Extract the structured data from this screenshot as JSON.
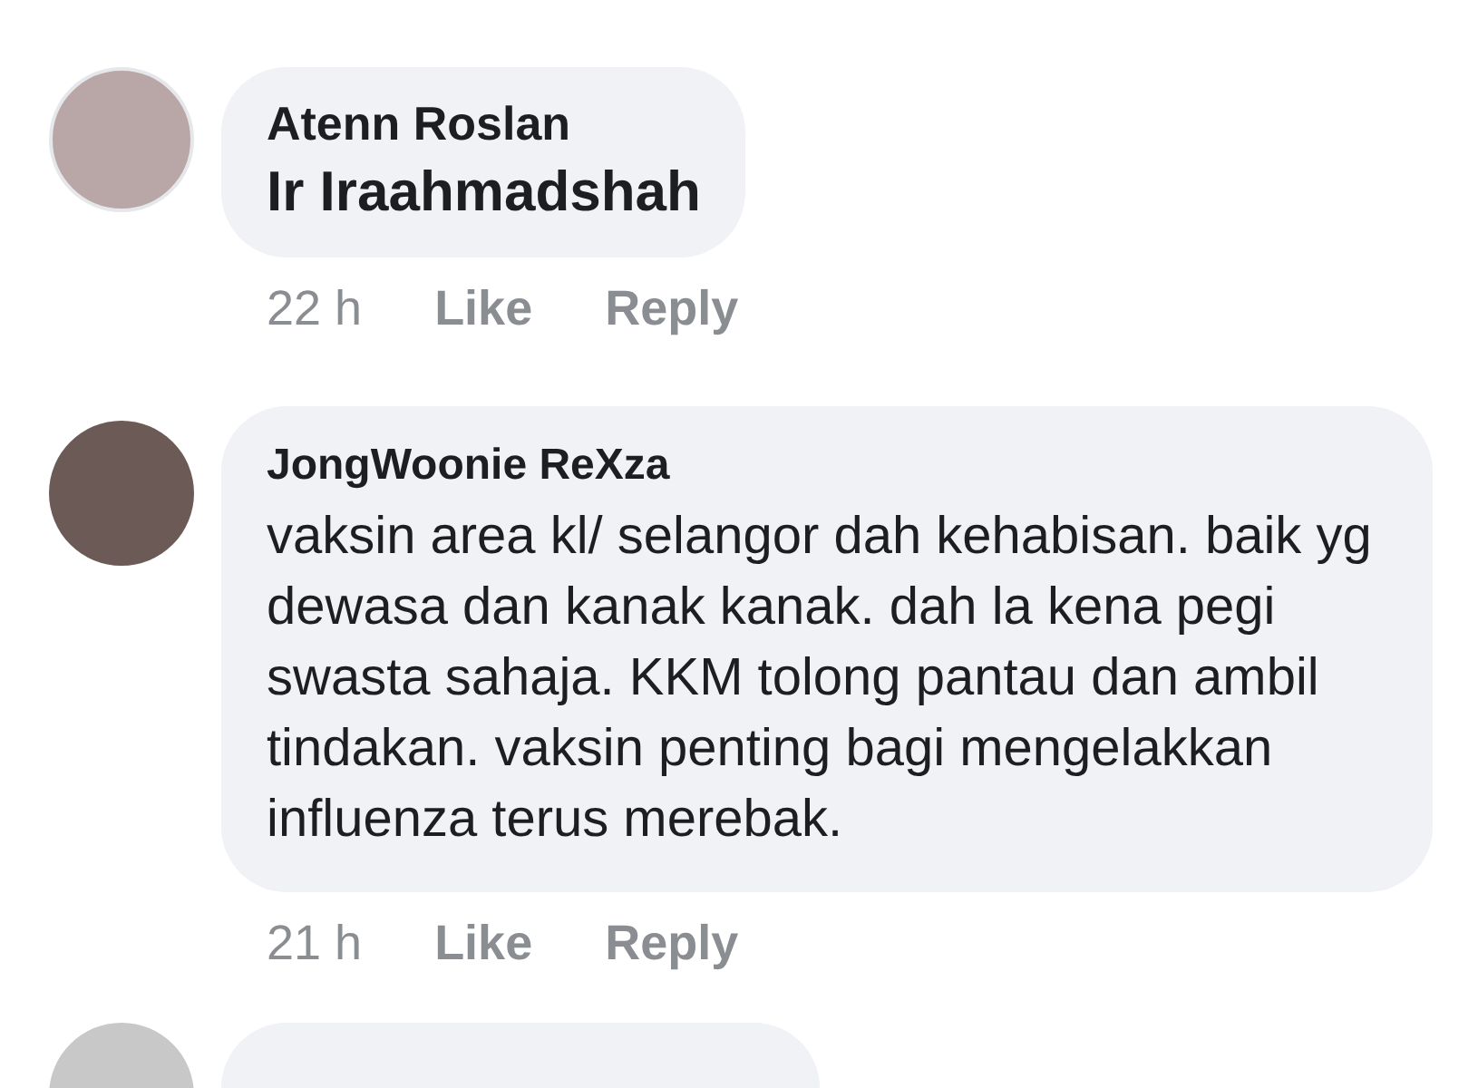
{
  "comments": [
    {
      "author": "Atenn Roslan",
      "kind": "tag",
      "text": "Ir Iraahmadshah",
      "time": "22 h",
      "actions": [
        "Like",
        "Reply"
      ]
    },
    {
      "author": "JongWoonie ReXza",
      "kind": "text",
      "text": "vaksin area kl/ selangor dah kehabisan. baik yg dewasa dan kanak kanak. dah la kena pegi swasta sahaja. KKM tolong pantau dan ambil tindakan. vaksin penting bagi mengelakkan influenza terus merebak.",
      "time": "21 h",
      "actions": [
        "Like",
        "Reply"
      ]
    }
  ]
}
